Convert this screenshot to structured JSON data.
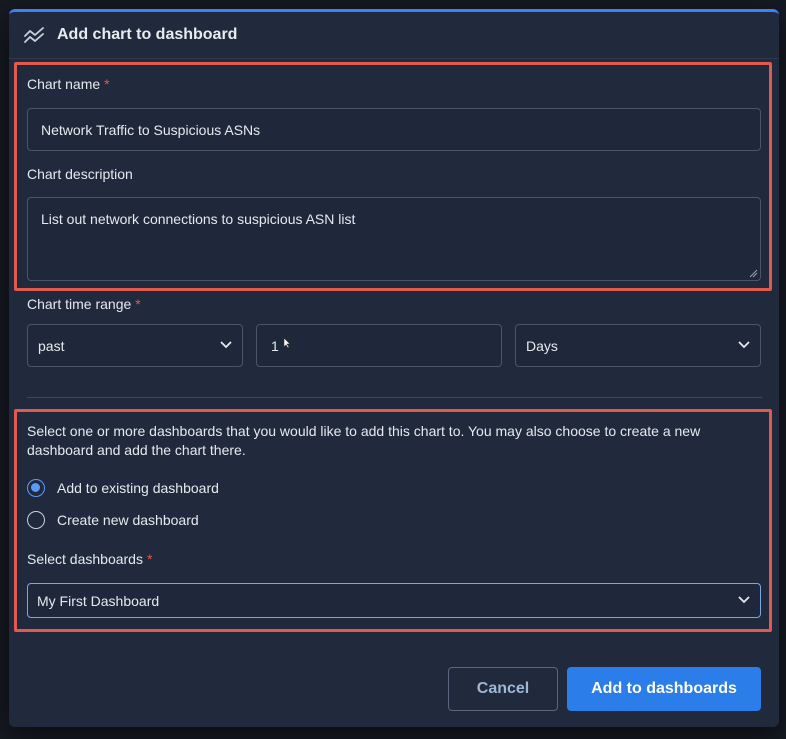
{
  "modal": {
    "title": "Add chart to dashboard",
    "icon": "chart-line-icon",
    "accent_color": "#3b82f6"
  },
  "chart_name": {
    "label": "Chart name",
    "required_mark": "*",
    "value": "Network Traffic to Suspicious ASNs"
  },
  "chart_description": {
    "label": "Chart description",
    "value": "List out network connections to suspicious ASN list"
  },
  "time_range": {
    "label": "Chart time range",
    "required_mark": "*",
    "relation": "past",
    "amount": "1",
    "unit": "Days"
  },
  "dashboards": {
    "instructions": "Select one or more dashboards that you would like to add this chart to. You may also choose to create a new dashboard and add the chart there.",
    "options": [
      {
        "label": "Add to existing dashboard",
        "checked": true
      },
      {
        "label": "Create new dashboard",
        "checked": false
      }
    ],
    "select_label": "Select dashboards",
    "required_mark": "*",
    "selected": "My First Dashboard"
  },
  "footer": {
    "cancel_label": "Cancel",
    "submit_label": "Add to dashboards"
  },
  "colors": {
    "highlight": "#e05a4f",
    "primary_button": "#2b7de9",
    "modal_bg": "#212a3d"
  }
}
